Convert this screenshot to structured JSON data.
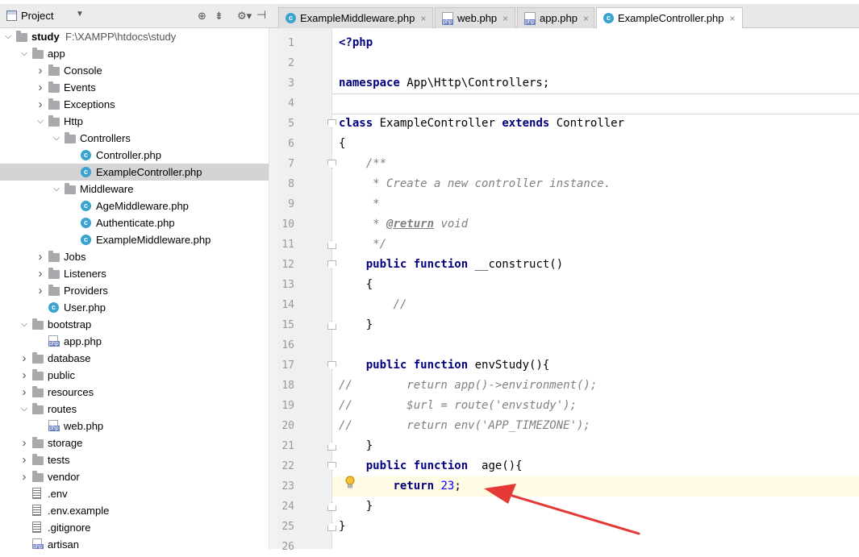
{
  "breadcrumb": [
    "study",
    "app",
    "Http",
    "Controllers",
    "ExampleController.php"
  ],
  "project_panel": {
    "title": "Project",
    "tree": [
      {
        "label": "study",
        "path": "F:\\XAMPP\\htdocs\\study",
        "depth": 0,
        "kind": "root",
        "expanded": true
      },
      {
        "label": "app",
        "depth": 1,
        "kind": "folder",
        "expanded": true
      },
      {
        "label": "Console",
        "depth": 2,
        "kind": "folder",
        "expanded": false
      },
      {
        "label": "Events",
        "depth": 2,
        "kind": "folder",
        "expanded": false
      },
      {
        "label": "Exceptions",
        "depth": 2,
        "kind": "folder",
        "expanded": false
      },
      {
        "label": "Http",
        "depth": 2,
        "kind": "folder",
        "expanded": true
      },
      {
        "label": "Controllers",
        "depth": 3,
        "kind": "folder",
        "expanded": true
      },
      {
        "label": "Controller.php",
        "depth": 4,
        "kind": "class"
      },
      {
        "label": "ExampleController.php",
        "depth": 4,
        "kind": "class",
        "selected": true
      },
      {
        "label": "Middleware",
        "depth": 3,
        "kind": "folder",
        "expanded": true
      },
      {
        "label": "AgeMiddleware.php",
        "depth": 4,
        "kind": "class"
      },
      {
        "label": "Authenticate.php",
        "depth": 4,
        "kind": "class"
      },
      {
        "label": "ExampleMiddleware.php",
        "depth": 4,
        "kind": "class"
      },
      {
        "label": "Jobs",
        "depth": 2,
        "kind": "folder",
        "expanded": false
      },
      {
        "label": "Listeners",
        "depth": 2,
        "kind": "folder",
        "expanded": false
      },
      {
        "label": "Providers",
        "depth": 2,
        "kind": "folder",
        "expanded": false
      },
      {
        "label": "User.php",
        "depth": 2,
        "kind": "class"
      },
      {
        "label": "bootstrap",
        "depth": 1,
        "kind": "folder",
        "expanded": true
      },
      {
        "label": "app.php",
        "depth": 2,
        "kind": "php"
      },
      {
        "label": "database",
        "depth": 1,
        "kind": "folder",
        "expanded": false
      },
      {
        "label": "public",
        "depth": 1,
        "kind": "folder",
        "expanded": false
      },
      {
        "label": "resources",
        "depth": 1,
        "kind": "folder",
        "expanded": false
      },
      {
        "label": "routes",
        "depth": 1,
        "kind": "folder",
        "expanded": true
      },
      {
        "label": "web.php",
        "depth": 2,
        "kind": "php"
      },
      {
        "label": "storage",
        "depth": 1,
        "kind": "folder",
        "expanded": false
      },
      {
        "label": "tests",
        "depth": 1,
        "kind": "folder",
        "expanded": false
      },
      {
        "label": "vendor",
        "depth": 1,
        "kind": "folder",
        "expanded": false
      },
      {
        "label": ".env",
        "depth": 1,
        "kind": "text"
      },
      {
        "label": ".env.example",
        "depth": 1,
        "kind": "text"
      },
      {
        "label": ".gitignore",
        "depth": 1,
        "kind": "text"
      },
      {
        "label": "artisan",
        "depth": 1,
        "kind": "php"
      }
    ]
  },
  "tabs": [
    {
      "label": "ExampleMiddleware.php",
      "icon": "class",
      "active": false
    },
    {
      "label": "web.php",
      "icon": "php",
      "active": false
    },
    {
      "label": "app.php",
      "icon": "php",
      "active": false
    },
    {
      "label": "ExampleController.php",
      "icon": "class",
      "active": true
    }
  ],
  "editor": {
    "current_line": 23,
    "lines": [
      {
        "n": "1",
        "tokens": [
          {
            "t": "<?php",
            "c": "tag"
          }
        ]
      },
      {
        "n": "2",
        "tokens": []
      },
      {
        "n": "3",
        "tokens": [
          {
            "t": "namespace",
            "c": "kw"
          },
          {
            "t": " App\\Http\\Controllers;",
            "c": ""
          }
        ]
      },
      {
        "n": "4",
        "tokens": []
      },
      {
        "n": "5",
        "tokens": [
          {
            "t": "class",
            "c": "kw"
          },
          {
            "t": " ExampleController ",
            "c": ""
          },
          {
            "t": "extends",
            "c": "kw"
          },
          {
            "t": " Controller",
            "c": ""
          }
        ]
      },
      {
        "n": "6",
        "tokens": [
          {
            "t": "{",
            "c": ""
          }
        ]
      },
      {
        "n": "7",
        "tokens": [
          {
            "t": "    /**",
            "c": "cm"
          }
        ]
      },
      {
        "n": "8",
        "tokens": [
          {
            "t": "     * Create a new controller instance.",
            "c": "cm"
          }
        ]
      },
      {
        "n": "9",
        "tokens": [
          {
            "t": "     *",
            "c": "cm"
          }
        ]
      },
      {
        "n": "10",
        "tokens": [
          {
            "t": "     * ",
            "c": "cm"
          },
          {
            "t": "@return",
            "c": "doc-tag"
          },
          {
            "t": " void",
            "c": "cm"
          }
        ]
      },
      {
        "n": "11",
        "tokens": [
          {
            "t": "     */",
            "c": "cm"
          }
        ]
      },
      {
        "n": "12",
        "tokens": [
          {
            "t": "    ",
            "c": ""
          },
          {
            "t": "public function",
            "c": "kw"
          },
          {
            "t": " __construct()",
            "c": ""
          }
        ]
      },
      {
        "n": "13",
        "tokens": [
          {
            "t": "    {",
            "c": ""
          }
        ]
      },
      {
        "n": "14",
        "tokens": [
          {
            "t": "        //",
            "c": "cm"
          }
        ]
      },
      {
        "n": "15",
        "tokens": [
          {
            "t": "    }",
            "c": ""
          }
        ]
      },
      {
        "n": "16",
        "tokens": []
      },
      {
        "n": "17",
        "tokens": [
          {
            "t": "    ",
            "c": ""
          },
          {
            "t": "public function",
            "c": "kw"
          },
          {
            "t": " envStudy(){",
            "c": ""
          }
        ]
      },
      {
        "n": "18",
        "tokens": [
          {
            "t": "//        return app()->environment();",
            "c": "cm"
          }
        ]
      },
      {
        "n": "19",
        "tokens": [
          {
            "t": "//        $url = route('envstudy');",
            "c": "cm"
          }
        ]
      },
      {
        "n": "20",
        "tokens": [
          {
            "t": "//        return env('APP_TIMEZONE');",
            "c": "cm"
          }
        ]
      },
      {
        "n": "21",
        "tokens": [
          {
            "t": "    }",
            "c": ""
          }
        ]
      },
      {
        "n": "22",
        "tokens": [
          {
            "t": "    ",
            "c": ""
          },
          {
            "t": "public function",
            "c": "kw"
          },
          {
            "t": "  age(){",
            "c": ""
          }
        ]
      },
      {
        "n": "23",
        "tokens": [
          {
            "t": "        ",
            "c": ""
          },
          {
            "t": "return",
            "c": "kw"
          },
          {
            "t": " ",
            "c": ""
          },
          {
            "t": "23",
            "c": "num"
          },
          {
            "t": ";",
            "c": ""
          }
        ]
      },
      {
        "n": "24",
        "tokens": [
          {
            "t": "    }",
            "c": ""
          }
        ]
      },
      {
        "n": "25",
        "tokens": [
          {
            "t": "}",
            "c": ""
          }
        ]
      },
      {
        "n": "26",
        "tokens": []
      }
    ]
  },
  "icons": {
    "panel": "project-icon",
    "gear": "gear-icon",
    "bulb": "lightbulb-icon"
  }
}
